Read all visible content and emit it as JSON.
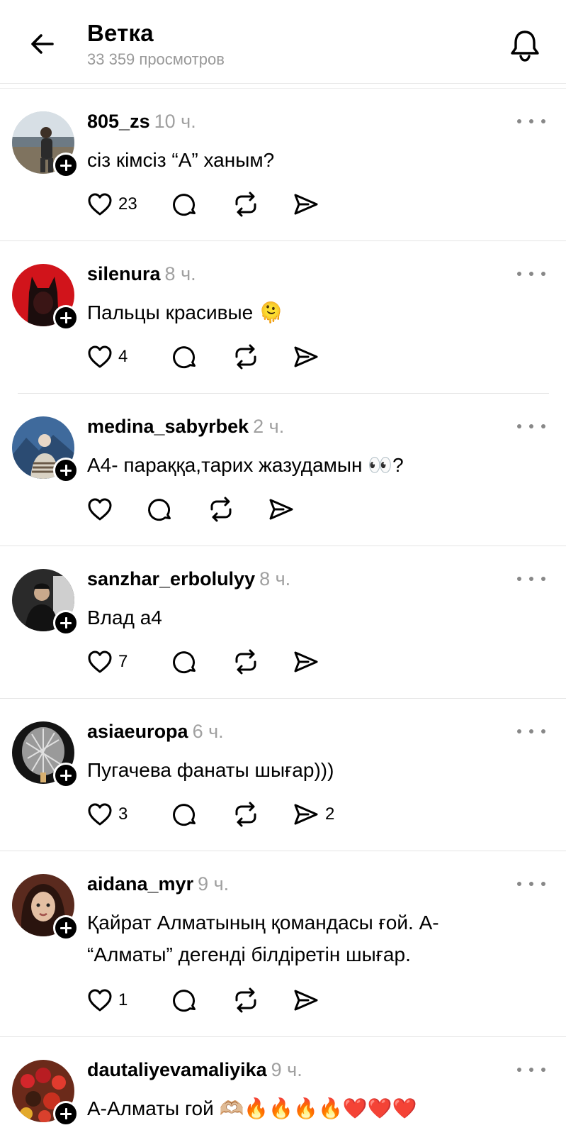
{
  "header": {
    "title": "Ветка",
    "views": "33 359 просмотров"
  },
  "posts": [
    {
      "username": "805_zs",
      "time": "10 ч.",
      "text": "сіз кімсіз “А” ханым?",
      "likes": "23",
      "shares": ""
    },
    {
      "username": "silenura",
      "time": "8 ч.",
      "text": "Пальцы красивые 🫠",
      "likes": "4",
      "shares": ""
    },
    {
      "username": "medina_sabyrbek",
      "time": "2 ч.",
      "text": "А4- параққа,тарих жазудамын 👀?",
      "likes": "",
      "shares": ""
    },
    {
      "username": "sanzhar_erbolulyy",
      "time": "8 ч.",
      "text": "Влад а4",
      "likes": "7",
      "shares": ""
    },
    {
      "username": "asiaeuropa",
      "time": "6 ч.",
      "text": "Пугачева фанаты шығар)))",
      "likes": "3",
      "shares": "2"
    },
    {
      "username": "aidana_myr",
      "time": "9 ч.",
      "text": "Қайрат Алматының қомандасы ғой. А- “Алматы” дегенді білдіретін шығар.",
      "likes": "1",
      "shares": ""
    },
    {
      "username": "dautaliyevamaliyika",
      "time": "9 ч.",
      "text": "А-Алматы гой 🫶🏼🔥🔥🔥🔥❤️❤️❤️",
      "likes": "",
      "shares": ""
    }
  ],
  "icons": {
    "back": "arrow-left-icon",
    "bell": "bell-icon",
    "more": "more-dots-icon",
    "like": "heart-icon",
    "comment": "comment-icon",
    "repost": "repost-icon",
    "share": "send-icon",
    "follow": "plus-icon"
  }
}
